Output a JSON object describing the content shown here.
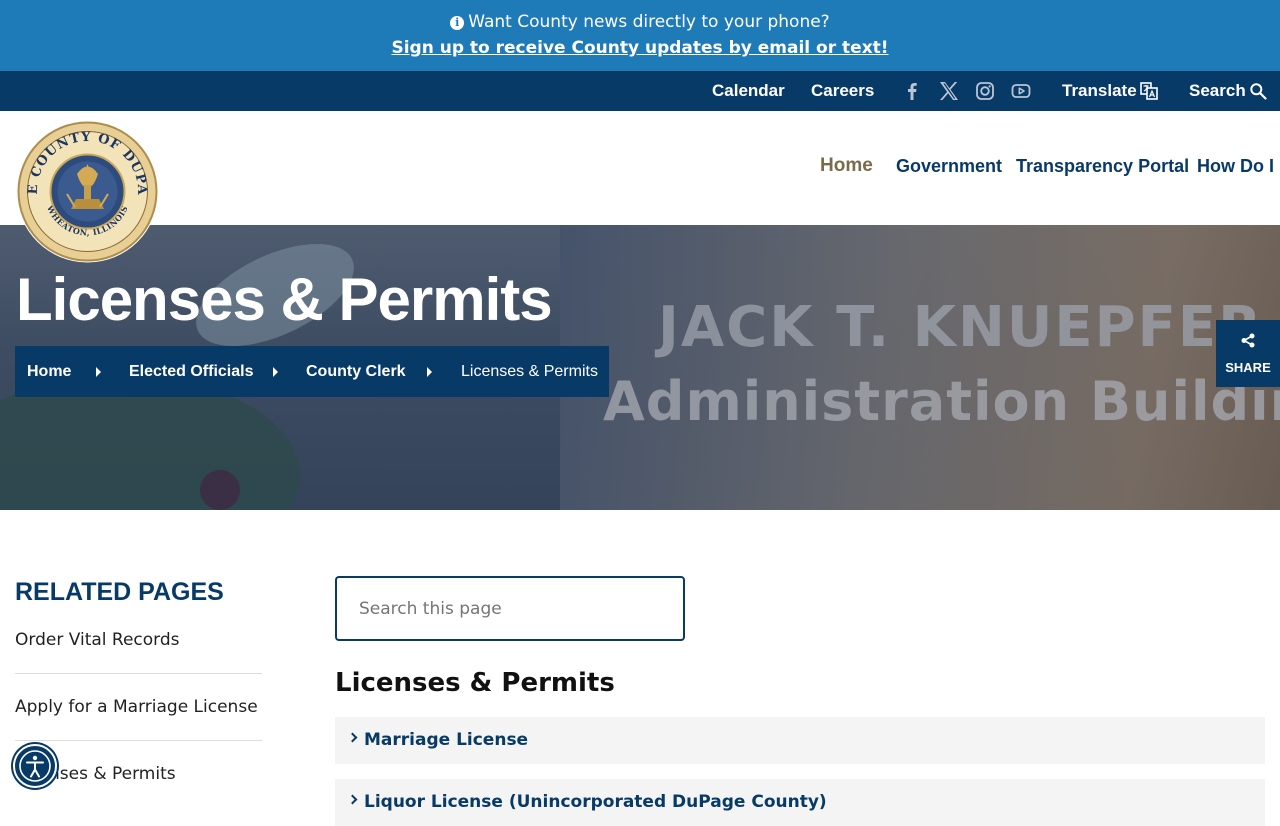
{
  "alert": {
    "message": "Want County news directly to your phone?",
    "link": "Sign up to receive County updates by email or text!"
  },
  "utility": {
    "calendar": "Calendar",
    "careers": "Careers",
    "social_icons": [
      "facebook-icon",
      "x-icon",
      "instagram-icon",
      "youtube-icon"
    ],
    "translate": "Translate",
    "search": "Search"
  },
  "seal": {
    "top_text": "THE COUNTY OF DUPAGE",
    "bottom_text": "WHEATON, ILLINOIS"
  },
  "nav": {
    "items": [
      "Home",
      "Government",
      "Transparency Portal",
      "How Do I"
    ],
    "active": "Home"
  },
  "hero": {
    "title": "Licenses & Permits",
    "background_text_1": "JACK T. KNUEPFER",
    "background_text_2": "Administration Building"
  },
  "breadcrumb": [
    "Home",
    "Elected Officials",
    "County Clerk",
    "Licenses & Permits"
  ],
  "share": {
    "label": "SHARE"
  },
  "sidebar": {
    "title": "RELATED PAGES",
    "items": [
      "Order Vital Records",
      "Apply for a Marriage License",
      "Licenses & Permits"
    ]
  },
  "main": {
    "search_placeholder": "Search this page",
    "title": "Licenses & Permits",
    "accordions": [
      "Marriage License",
      "Liquor License (Unincorporated DuPage County)"
    ]
  },
  "colors": {
    "alert_bg": "#1f7ab8",
    "navy": "#083a67",
    "active_nav": "#7a6b4a"
  }
}
